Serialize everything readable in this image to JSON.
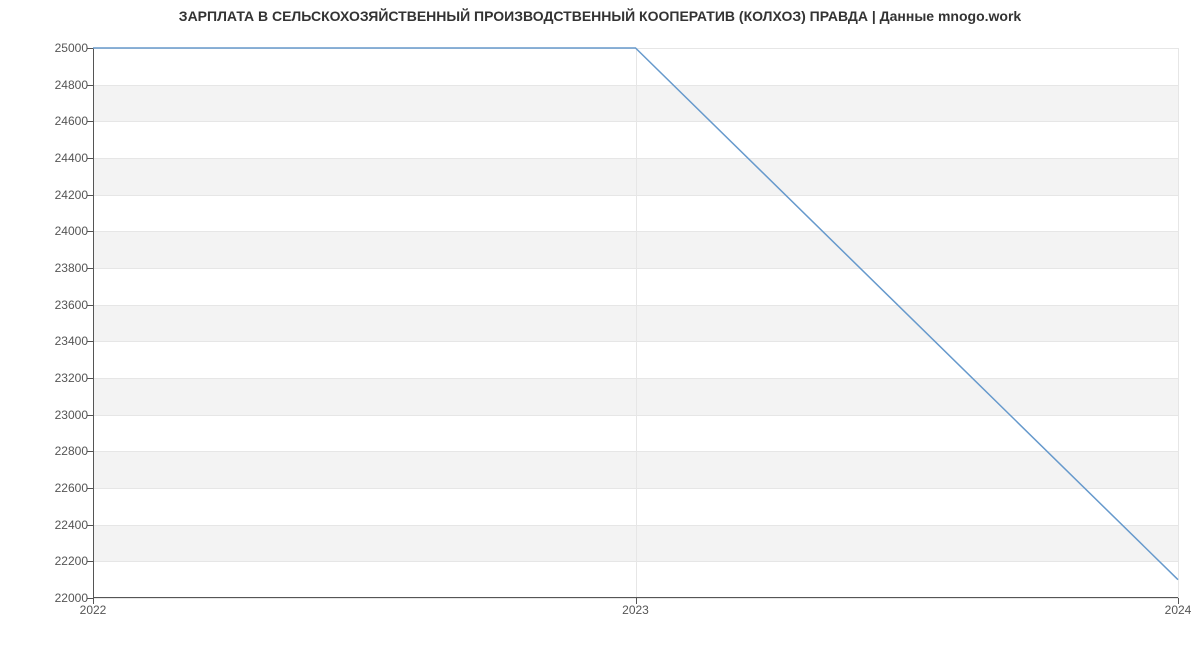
{
  "chart_data": {
    "type": "line",
    "title": "ЗАРПЛАТА В СЕЛЬСКОХОЗЯЙСТВЕННЫЙ ПРОИЗВОДСТВЕННЫЙ КООПЕРАТИВ (КОЛХОЗ) ПРАВДА | Данные mnogo.work",
    "x": [
      2022,
      2023,
      2024
    ],
    "values": [
      25000,
      25000,
      22100
    ],
    "x_ticks": [
      2022,
      2023,
      2024
    ],
    "y_ticks": [
      22000,
      22200,
      22400,
      22600,
      22800,
      23000,
      23200,
      23400,
      23600,
      23800,
      24000,
      24200,
      24400,
      24600,
      24800,
      25000
    ],
    "xlim": [
      2022,
      2024
    ],
    "ylim": [
      22000,
      25000
    ],
    "line_color": "#6699cc",
    "band_color": "#f3f3f3",
    "xlabel": "",
    "ylabel": ""
  }
}
